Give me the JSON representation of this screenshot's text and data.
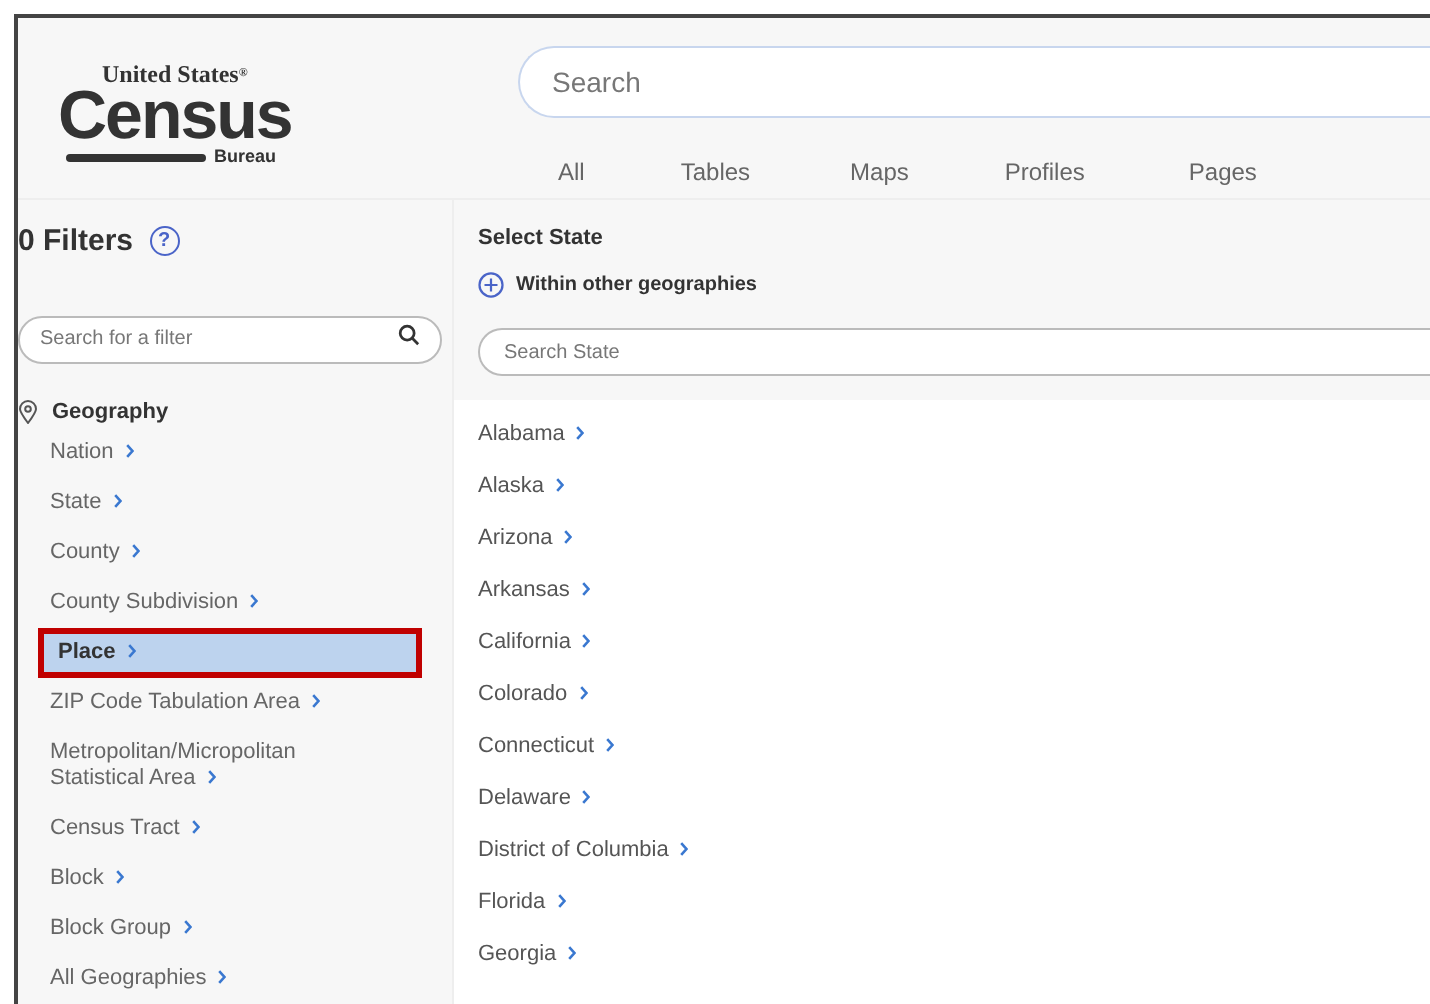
{
  "header": {
    "logo": {
      "top": "United States",
      "reg": "®",
      "main": "Census",
      "sub": "Bureau"
    },
    "search": {
      "placeholder": "Search"
    },
    "tabs": [
      {
        "label": "All",
        "selected": false
      },
      {
        "label": "Tables",
        "selected": false
      },
      {
        "label": "Maps",
        "selected": false
      },
      {
        "label": "Profiles",
        "selected": false
      },
      {
        "label": "Pages",
        "selected": false
      }
    ]
  },
  "sidebar": {
    "title": "0 Filters",
    "help": "?",
    "filter_search": {
      "placeholder": "Search for a filter"
    },
    "section": "Geography",
    "items": [
      {
        "label": "Nation",
        "selected": false,
        "highlighted": false
      },
      {
        "label": "State",
        "selected": false,
        "highlighted": false
      },
      {
        "label": "County",
        "selected": false,
        "highlighted": false
      },
      {
        "label": "County Subdivision",
        "selected": false,
        "highlighted": false
      },
      {
        "label": "Place",
        "selected": true,
        "highlighted": true
      },
      {
        "label": "ZIP Code Tabulation Area",
        "selected": false,
        "highlighted": false
      },
      {
        "label": "Metropolitan/Micropolitan Statistical Area",
        "selected": false,
        "highlighted": false
      },
      {
        "label": "Census Tract",
        "selected": false,
        "highlighted": false
      },
      {
        "label": "Block",
        "selected": false,
        "highlighted": false
      },
      {
        "label": "Block Group",
        "selected": false,
        "highlighted": false
      },
      {
        "label": "All Geographies",
        "selected": false,
        "highlighted": false
      }
    ]
  },
  "main": {
    "title": "Select State",
    "within": "Within other geographies",
    "state_search": {
      "placeholder": "Search State"
    },
    "states": [
      "Alabama",
      "Alaska",
      "Arizona",
      "Arkansas",
      "California",
      "Colorado",
      "Connecticut",
      "Delaware",
      "District of Columbia",
      "Florida",
      "Georgia"
    ]
  }
}
